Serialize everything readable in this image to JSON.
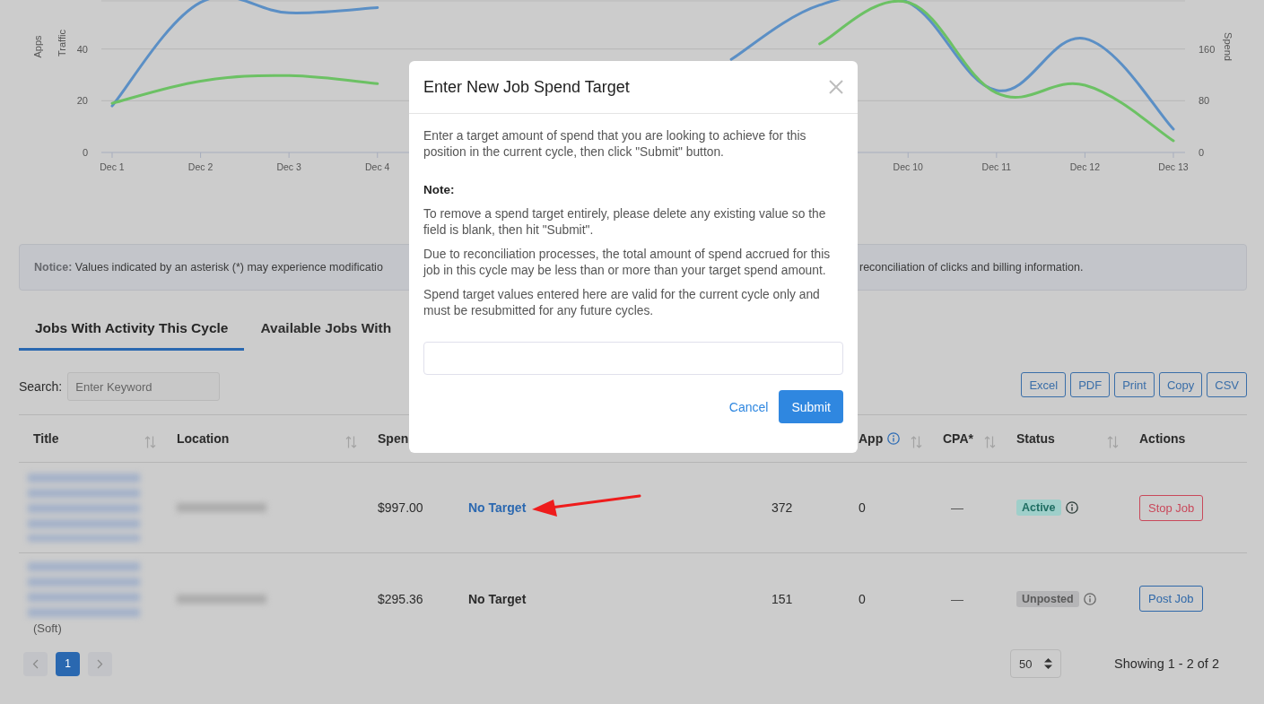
{
  "chart": {
    "chart_data": {
      "type": "line",
      "ylabel": "Traffic",
      "y2label": "Spend",
      "annotations": [
        {
          "text": "Apps"
        }
      ],
      "categories": [
        "Dec 1",
        "Dec 2",
        "Dec 3",
        "Dec 4",
        null,
        null,
        null,
        null,
        null,
        "Dec 10",
        "Dec 11",
        "Dec 12",
        "Dec 13"
      ],
      "ylim": [
        0,
        58.6
      ],
      "yticks": [
        0,
        20,
        40
      ],
      "y2lim": [
        0,
        234.4
      ],
      "y2ticks": [
        0,
        80,
        160
      ],
      "series": [
        {
          "color": "#5b8fc5",
          "values": [
            18,
            58,
            54,
            56,
            null,
            null,
            null,
            36,
            57,
            58,
            24,
            44,
            9
          ]
        },
        {
          "color": "#6cc164",
          "values": [
            19,
            27.6,
            29.7,
            26.6,
            null,
            null,
            null,
            null,
            42,
            58,
            23,
            26,
            4.5
          ]
        }
      ]
    }
  },
  "notice": {
    "text_start": "**Notice:** Values indicated by an asterisk (*) may experience modificatio",
    "text_end": "reconciliation of clicks and billing information."
  },
  "tabs": [
    {
      "label": "Jobs With Activity This Cycle",
      "selected": true
    },
    {
      "label": "Available Jobs With",
      "selected": false
    }
  ],
  "search": {
    "label": "Search:",
    "placeholder": "Enter Keyword"
  },
  "export_buttons": [
    "Excel",
    "PDF",
    "Print",
    "Copy",
    "CSV"
  ],
  "table": {
    "columns": [
      {
        "label": "Title",
        "sortable": true,
        "info": false
      },
      {
        "label": "Location",
        "sortable": true,
        "info": false
      },
      {
        "label": "Spen"
      },
      {},
      {},
      {
        "label": "App",
        "sortable": true,
        "info": true
      },
      {
        "label": "CPA*",
        "sortable": true,
        "info": false
      },
      {
        "label": "Status",
        "sortable": true,
        "info": false
      },
      {
        "label": "Actions",
        "sortable": false,
        "info": false
      }
    ],
    "rows": [
      {
        "spend": "$997.00",
        "target": "No Target",
        "target_link": true,
        "column_5": "372",
        "app": "0",
        "cpa": "—",
        "status": {
          "label": "Active",
          "kind": "active"
        },
        "action": {
          "label": "Stop Job",
          "kind": "stop"
        }
      },
      {
        "title_note": "(Soft)",
        "spend": "$295.36",
        "target": "No Target",
        "target_link": false,
        "column_5": "151",
        "app": "0",
        "cpa": "—",
        "status": {
          "label": "Unposted",
          "kind": "unposted"
        },
        "action": {
          "label": "Post Job",
          "kind": "post"
        }
      }
    ]
  },
  "pagination": {
    "pages": [
      {
        "label": "1",
        "selected": true
      }
    ],
    "page_size": "50",
    "summary": "Showing 1 - 2 of 2"
  },
  "modal": {
    "title": "Enter New Job Spend Target",
    "intro": "Enter a target amount of spend that you are looking to achieve for this position in the current cycle, then click \"Submit\" button.",
    "note_label": "Note:",
    "notes": [
      "To remove a spend target entirely, please delete any existing value so the field is blank, then hit \"Submit\".",
      "Due to reconciliation processes, the total amount of spend accrued for this job in this cycle may be less than or more than your target spend amount.",
      "Spend target values entered here are valid for the current cycle only and must be resubmitted for any future cycles."
    ],
    "cancel": "Cancel",
    "submit": "Submit"
  }
}
